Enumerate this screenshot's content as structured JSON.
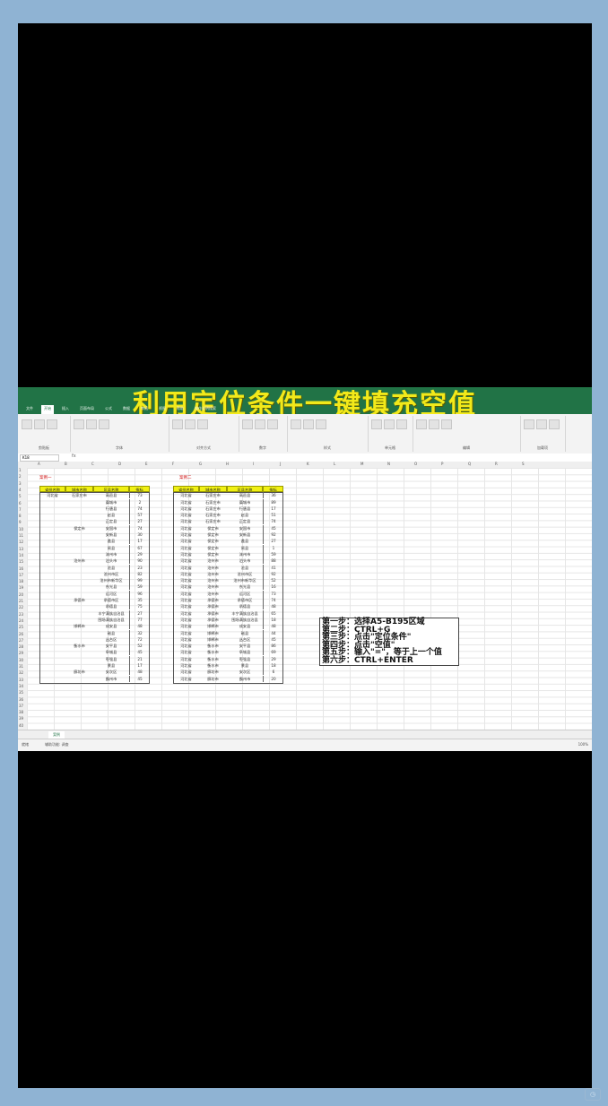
{
  "headline": "利用定位条件一键填充空值",
  "ribbon_tabs": [
    "文件",
    "开始",
    "插入",
    "页面布局",
    "公式",
    "数据",
    "审阅",
    "视图",
    "帮助",
    "操作说明搜索"
  ],
  "ribbon_groups": [
    "剪贴板",
    "字体",
    "对齐方式",
    "数字",
    "样式",
    "单元格",
    "编辑",
    "加载项"
  ],
  "namebox": "K18",
  "fx": "fx",
  "columns": [
    "A",
    "B",
    "C",
    "D",
    "E",
    "F",
    "G",
    "H",
    "I",
    "J",
    "K",
    "L",
    "M",
    "N",
    "O",
    "P",
    "Q",
    "R",
    "S"
  ],
  "label_left": "案例一",
  "label_right": "案例二",
  "table_headers": [
    "省份名称",
    "城市名称",
    "区县名称",
    "指标"
  ],
  "left_table": [
    [
      "河北省",
      "石家庄市",
      "高邑县",
      "73"
    ],
    [
      "",
      "",
      "藁城市",
      "2"
    ],
    [
      "",
      "",
      "行唐县",
      "74"
    ],
    [
      "",
      "",
      "赵县",
      "57"
    ],
    [
      "",
      "",
      "正定县",
      "27"
    ],
    [
      "",
      "保定市",
      "安国市",
      "74"
    ],
    [
      "",
      "",
      "安新县",
      "30"
    ],
    [
      "",
      "",
      "蠡县",
      "17"
    ],
    [
      "",
      "",
      "易县",
      "67"
    ],
    [
      "",
      "",
      "涞州市",
      "29"
    ],
    [
      "",
      "沧州市",
      "泊头市",
      "90"
    ],
    [
      "",
      "",
      "沧县",
      "23"
    ],
    [
      "",
      "",
      "沧州市区",
      "82"
    ],
    [
      "",
      "",
      "沧州市新华区",
      "99"
    ],
    [
      "",
      "",
      "东光县",
      "59"
    ],
    [
      "",
      "",
      "运河区",
      "96"
    ],
    [
      "",
      "承德市",
      "承德市区",
      "35"
    ],
    [
      "",
      "",
      "承德县",
      "75"
    ],
    [
      "",
      "",
      "丰宁满族自治县",
      "27"
    ],
    [
      "",
      "",
      "围场满族自治县",
      "77"
    ],
    [
      "",
      "邯郸市",
      "成安县",
      "48"
    ],
    [
      "",
      "",
      "磁县",
      "32"
    ],
    [
      "",
      "",
      "丛台区",
      "72"
    ],
    [
      "",
      "衡水市",
      "安平县",
      "52"
    ],
    [
      "",
      "",
      "阜城县",
      "45"
    ],
    [
      "",
      "",
      "枣强县",
      "21"
    ],
    [
      "",
      "",
      "景县",
      "17"
    ],
    [
      "",
      "廊坊市",
      "安次区",
      "48"
    ],
    [
      "",
      "",
      "霸州市",
      "45"
    ]
  ],
  "right_table": [
    [
      "河北省",
      "石家庄市",
      "高邑县",
      "36"
    ],
    [
      "河北省",
      "石家庄市",
      "藁城市",
      "89"
    ],
    [
      "河北省",
      "石家庄市",
      "行唐县",
      "17"
    ],
    [
      "河北省",
      "石家庄市",
      "赵县",
      "51"
    ],
    [
      "河北省",
      "石家庄市",
      "正定县",
      "74"
    ],
    [
      "河北省",
      "保定市",
      "安国市",
      "45"
    ],
    [
      "河北省",
      "保定市",
      "安新县",
      "92"
    ],
    [
      "河北省",
      "保定市",
      "蠡县",
      "27"
    ],
    [
      "河北省",
      "保定市",
      "易县",
      "1"
    ],
    [
      "河北省",
      "保定市",
      "涞州市",
      "59"
    ],
    [
      "河北省",
      "沧州市",
      "泊头市",
      "88"
    ],
    [
      "河北省",
      "沧州市",
      "沧县",
      "41"
    ],
    [
      "河北省",
      "沧州市",
      "沧州市区",
      "92"
    ],
    [
      "河北省",
      "沧州市",
      "沧州市新华区",
      "52"
    ],
    [
      "河北省",
      "沧州市",
      "东光县",
      "16"
    ],
    [
      "河北省",
      "沧州市",
      "运河区",
      "73"
    ],
    [
      "河北省",
      "承德市",
      "承德市区",
      "74"
    ],
    [
      "河北省",
      "承德市",
      "承德县",
      "48"
    ],
    [
      "河北省",
      "承德市",
      "丰宁满族自治县",
      "65"
    ],
    [
      "河北省",
      "承德市",
      "围场满族自治县",
      "18"
    ],
    [
      "河北省",
      "邯郸市",
      "成安县",
      "48"
    ],
    [
      "河北省",
      "邯郸市",
      "磁县",
      "44"
    ],
    [
      "河北省",
      "邯郸市",
      "丛台区",
      "45"
    ],
    [
      "河北省",
      "衡水市",
      "安平县",
      "86"
    ],
    [
      "河北省",
      "衡水市",
      "阜城县",
      "69"
    ],
    [
      "河北省",
      "衡水市",
      "枣强县",
      "29"
    ],
    [
      "河北省",
      "衡水市",
      "景县",
      "18"
    ],
    [
      "河北省",
      "廊坊市",
      "安次区",
      "6"
    ],
    [
      "河北省",
      "廊坊市",
      "霸州市",
      "20"
    ]
  ],
  "steps": [
    "第一步：选择A5-B195区域",
    "第二步：CTRL+G",
    "第三步：点击\"定位条件\"",
    "第四步：点击\"空值\"",
    "第五步：输入\"=\"，等于上一个值",
    "第六步：CTRL+ENTER"
  ],
  "sheet_tab": "案例",
  "status_left": "就绪",
  "status_access": "辅助功能: 调查",
  "zoom": "100%",
  "colors": {
    "excel_green": "#217346",
    "header_yellow": "#f0f013",
    "headline_yellow": "#f2e91a",
    "frame_blue": "#8fb3d3"
  }
}
